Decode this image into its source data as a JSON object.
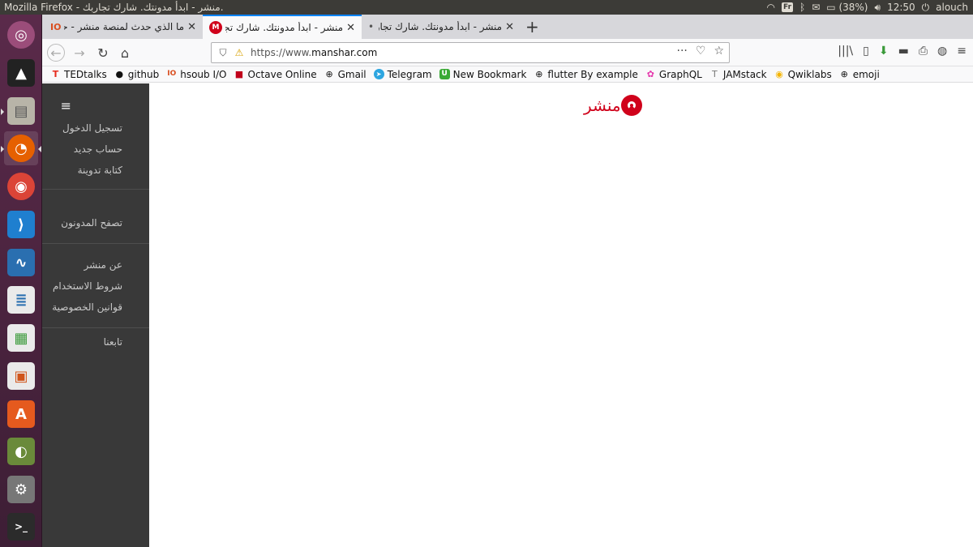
{
  "topbar": {
    "window_title": "Mozilla Firefox - منشر - ابدأ مدونتك. شارك تجاربك.",
    "kbd_layout": "Fr",
    "battery": "(38%)",
    "time": "12:50",
    "user": "alouch"
  },
  "tabs": [
    {
      "label": "ما الذي حدث لمنصة منشر - حـ",
      "favicon": "IO"
    },
    {
      "label": "منشر - ابدأ مدونتك. شارك تجار",
      "favicon": "M"
    },
    {
      "label": "منشر - ابدأ مدونتك. شارك تجار",
      "favicon": "•"
    }
  ],
  "navbar": {
    "url_prefix": "https://www.",
    "url_domain": "manshar.com"
  },
  "bookmarks": [
    {
      "label": "TEDtalks",
      "icon": "T"
    },
    {
      "label": "github",
      "icon": "●"
    },
    {
      "label": "hsoub I/O",
      "icon": "IO"
    },
    {
      "label": "Octave Online",
      "icon": "■"
    },
    {
      "label": "Gmail",
      "icon": "⊕"
    },
    {
      "label": "Telegram",
      "icon": "➤"
    },
    {
      "label": "New Bookmark",
      "icon": "U"
    },
    {
      "label": "flutter By example",
      "icon": "⊕"
    },
    {
      "label": "GraphQL",
      "icon": "✿"
    },
    {
      "label": "JAMstack",
      "icon": "T"
    },
    {
      "label": "Qwiklabs",
      "icon": "◉"
    },
    {
      "label": "emoji",
      "icon": "⊕"
    }
  ],
  "sidebar": {
    "menu_icon": "≡",
    "group1": [
      "تسجيل الدخول",
      "حساب جديد",
      "كتابة تدوينة"
    ],
    "group2": [
      "تصفح المدونون"
    ],
    "group3": [
      "عن منشر",
      "شروط الاستخدام",
      "قوانين الخصوصية"
    ],
    "group4": [
      "تابعنا"
    ]
  },
  "logo": {
    "text": "منشر"
  },
  "colors": {
    "brand": "#d0021b",
    "sidebar_bg": "#393939"
  }
}
